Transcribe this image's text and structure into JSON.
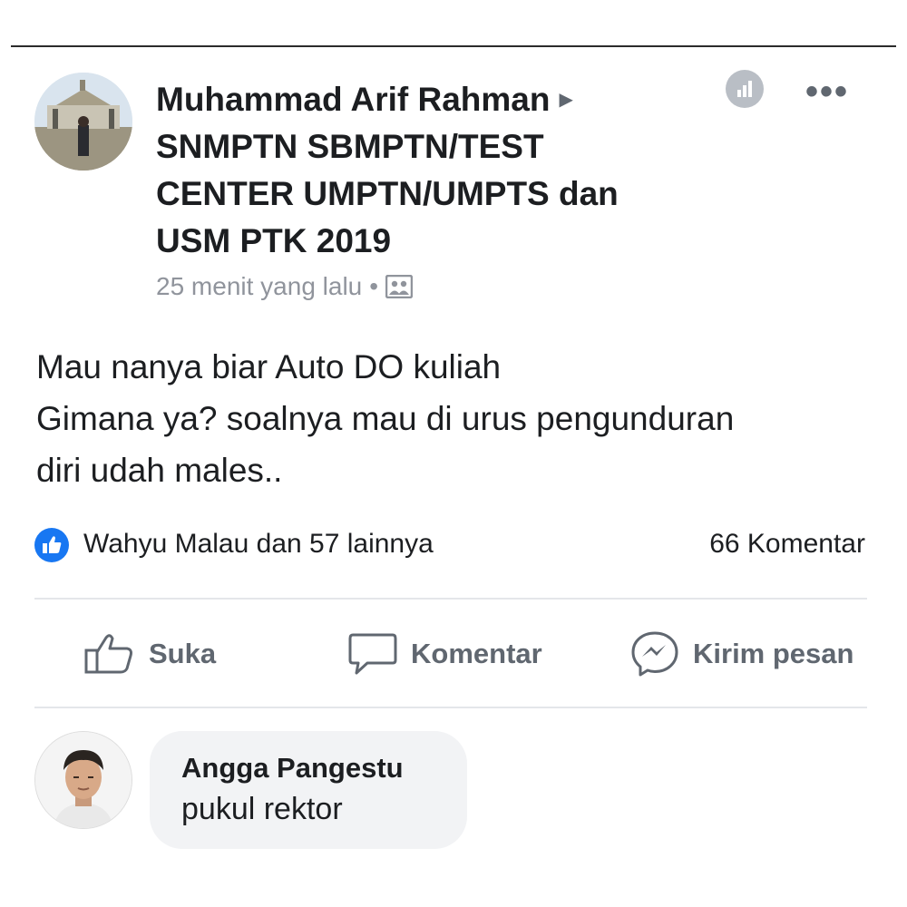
{
  "post": {
    "author": "Muhammad Arif Rahman",
    "group_lines": [
      "SNMPTN SBMPTN/TEST",
      "CENTER UMPTN/UMPTS dan",
      "USM PTK 2019"
    ],
    "timestamp": "25 menit yang lalu",
    "separator": "•",
    "body_lines": [
      "Mau nanya biar Auto DO kuliah",
      "Gimana ya? soalnya mau di urus pengunduran",
      "diri udah males.."
    ],
    "reactions_text": "Wahyu Malau dan 57 lainnya",
    "comments_count": "66 Komentar"
  },
  "actions": {
    "like_label": "Suka",
    "comment_label": "Komentar",
    "message_label": "Kirim pesan"
  },
  "comment": {
    "author": "Angga Pangestu",
    "text": "pukul rektor"
  },
  "icons": {
    "arrow": "arrow-right-icon",
    "insights": "insights-icon",
    "more": "more-icon",
    "audience": "group-audience-icon",
    "like_badge": "like-badge-icon",
    "like": "thumbs-up-icon",
    "comment": "comment-bubble-icon",
    "message": "messenger-icon"
  },
  "colors": {
    "accent": "#1877f2",
    "secondary_text": "#606770",
    "meta_text": "#90949c",
    "bubble": "#f2f3f5"
  }
}
